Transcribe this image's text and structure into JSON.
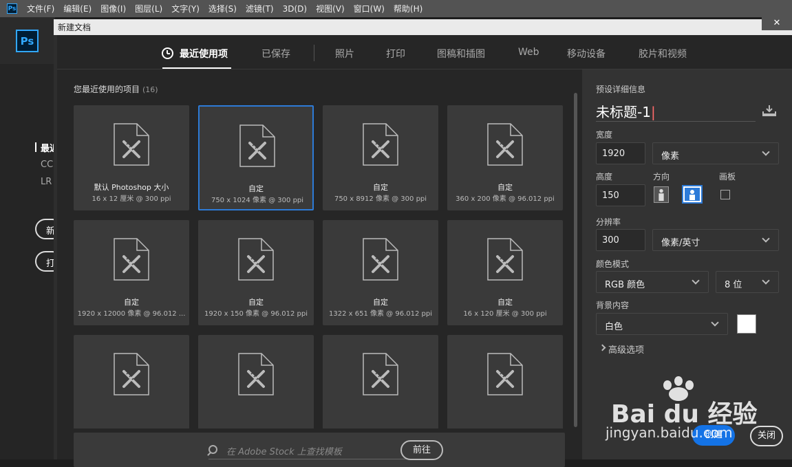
{
  "menubar": {
    "app_icon": "Ps",
    "items": [
      "文件(F)",
      "编辑(E)",
      "图像(I)",
      "图层(L)",
      "文字(Y)",
      "选择(S)",
      "滤镜(T)",
      "3D(D)",
      "视图(V)",
      "窗口(W)",
      "帮助(H)"
    ]
  },
  "home": {
    "logo": "Ps",
    "nav": [
      "最近",
      "CC",
      "LR"
    ],
    "buttons": [
      "新建",
      "打开"
    ]
  },
  "dialog": {
    "title": "新建文档",
    "close_glyph": "✕",
    "tabs": [
      "最近使用项",
      "已保存",
      "照片",
      "打印",
      "图稿和插图",
      "Web",
      "移动设备",
      "胶片和视频"
    ],
    "active_tab": "最近使用项"
  },
  "recent": {
    "title": "您最近使用的项目",
    "count": "(16)",
    "cards": [
      {
        "name": "默认 Photoshop 大小",
        "spec": "16 x 12 厘米 @ 300 ppi"
      },
      {
        "name": "自定",
        "spec": "750 x 1024 像素 @ 300 ppi"
      },
      {
        "name": "自定",
        "spec": "750 x 8912 像素 @ 300 ppi"
      },
      {
        "name": "自定",
        "spec": "360 x 200 像素 @ 96.012 ppi"
      },
      {
        "name": "自定",
        "spec": "1920 x 12000 像素 @ 96.012 ..."
      },
      {
        "name": "自定",
        "spec": "1920 x 150 像素 @ 96.012 ppi"
      },
      {
        "name": "自定",
        "spec": "1322 x 651 像素 @ 96.012 ppi"
      },
      {
        "name": "自定",
        "spec": "16 x 120 厘米 @ 300 ppi"
      },
      {
        "name": "",
        "spec": ""
      },
      {
        "name": "",
        "spec": ""
      },
      {
        "name": "",
        "spec": ""
      },
      {
        "name": "",
        "spec": ""
      }
    ],
    "selected_index": 1
  },
  "stock": {
    "placeholder": "在 Adobe Stock 上查找模板",
    "go_label": "前往"
  },
  "preset": {
    "section_title": "预设详细信息",
    "doc_name": "未标题-1",
    "width_label": "宽度",
    "width_value": "1920",
    "width_unit": "像素",
    "height_label": "高度",
    "height_value": "150",
    "orientation_label": "方向",
    "artboard_label": "画板",
    "resolution_label": "分辨率",
    "resolution_value": "300",
    "resolution_unit": "像素/英寸",
    "color_mode_label": "颜色模式",
    "color_mode": "RGB 颜色",
    "bit_depth": "8 位",
    "background_label": "背景内容",
    "background": "白色",
    "background_color": "#ffffff",
    "advanced_label": "高级选项",
    "create_label": "创建",
    "close_label": "关闭"
  },
  "watermark": {
    "main": "Bai du 经验",
    "url": "jingyan.baidu.com"
  },
  "colors": {
    "accent": "#1473e6",
    "ps_blue": "#31a8ff",
    "selected_border": "#2d7bd8"
  }
}
